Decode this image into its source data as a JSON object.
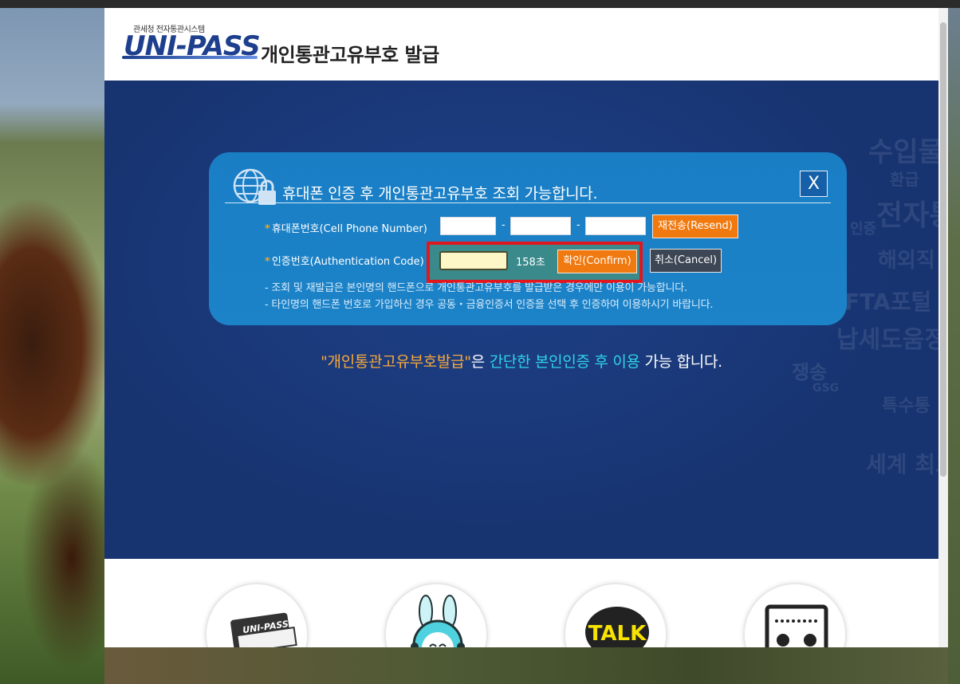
{
  "header": {
    "logo_subtitle": "관세청 전자통관시스템",
    "logo_text": "UNI-PASS",
    "title": "개인통관고유부호 발급"
  },
  "modal": {
    "title": "휴대폰 인증 후 개인통관고유부호 조회 가능합니다.",
    "close_label": "X",
    "phone_label": "휴대폰번호(Cell Phone Number)",
    "phone_parts": [
      "",
      "",
      ""
    ],
    "phone_separator": "-",
    "resend_label": "재전송(Resend)",
    "auth_label": "인증번호(Authentication Code)",
    "auth_value": "",
    "countdown": "158초",
    "confirm_label": "확인(Confirm)",
    "cancel_label": "취소(Cancel)",
    "notes": [
      "- 조회 및 재발급은 본인명의 핸드폰으로 개인통관고유부호를 발급받은 경우에만 이용이 가능합니다.",
      "- 타인명의 핸드폰 번호로 가입하신 경우 공동・금융인증서 인증을 선택 후 인증하여 이용하시기 바랍니다."
    ],
    "required_mark": "*"
  },
  "hero_caption": {
    "part1": "\"개인통관고유부호발급\"",
    "part2": "은 ",
    "part3": "간단한 본인인증 후 이용",
    "part4": " 가능 합니다."
  },
  "watermark_words": [
    "수입물",
    "환급",
    "전자통",
    "인증",
    "해외직",
    "FTA포털",
    "납세도움정보",
    "쟁송",
    "GSG",
    "특수통",
    "세계 최고"
  ],
  "bottom_icons": [
    "uni-pass-book-icon",
    "rabbit-mascot-icon",
    "kakao-talk-icon",
    "consultation-board-icon"
  ],
  "bottom_icon_text": {
    "uni_pass": "UNI-PASS",
    "talk": "TALK"
  },
  "colors": {
    "accent_orange": "#f07a10",
    "highlight_red": "#e0171f",
    "modal_blue": "#1a7ec5",
    "hero_navy": "#1b3a7c",
    "caption_cyan": "#2fd4e8",
    "caption_orange": "#f8a93a"
  }
}
